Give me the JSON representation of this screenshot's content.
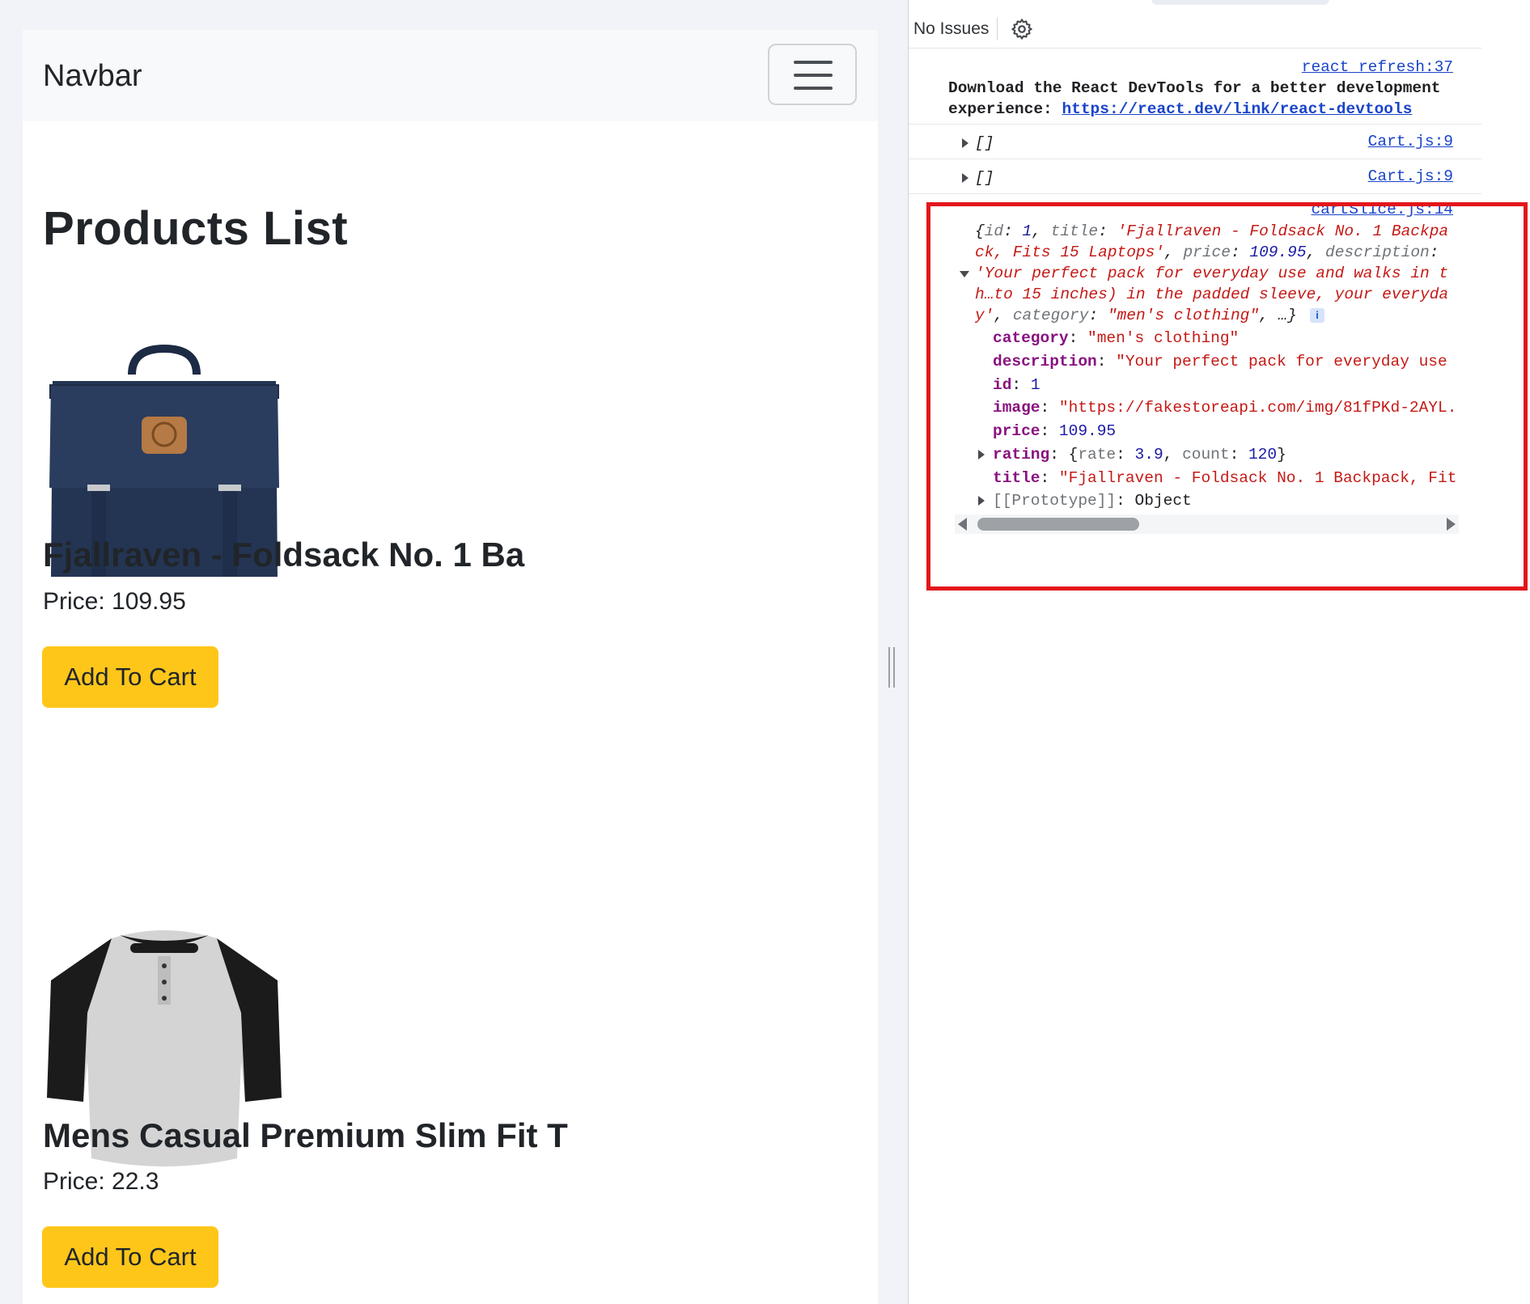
{
  "app": {
    "navbar": {
      "brand": "Navbar"
    },
    "page_title": "Products List",
    "products": [
      {
        "title": "Fjallraven - Foldsack No. 1 Ba",
        "price_text": "Price: 109.95",
        "button_label": "Add To Cart"
      },
      {
        "title": "Mens Casual Premium Slim Fit T",
        "price_text": "Price: 22.3",
        "button_label": "Add To Cart"
      }
    ]
  },
  "devtools": {
    "toolbar": {
      "issues_label": "No Issues"
    },
    "console": {
      "message1": {
        "source": "react_refresh:37",
        "text": "Download the React DevTools for a better development",
        "text2": "experience: ",
        "link": "https://react.dev/link/react-devtools"
      },
      "log1": {
        "value": "[]",
        "source": "Cart.js:9"
      },
      "log2": {
        "value": "[]",
        "source": "Cart.js:9"
      },
      "log3": {
        "source": "cartSlice.js:14",
        "summary": {
          "l1_open": "{",
          "l1_k1": "id",
          "l1_v1": "1",
          "l1_k2": "title",
          "l1_v2": "'Fjallraven - Foldsack No. 1 Backpa",
          "l2_v": "ck, Fits 15 Laptops'",
          "l2_k3": "price",
          "l2_v3": "109.95",
          "l2_k4": "description",
          "l3_v": "'Your perfect pack for everyday use and walks in t",
          "l4_v": "h…to 15 inches) in the padded sleeve, your everyda",
          "l5_v": "y'",
          "l5_k5": "category",
          "l5_v5": "\"men's clothing\"",
          "l5_close": ", …}",
          "info": "i"
        },
        "props": [
          {
            "key": "category",
            "value": "\"men's clothing\"",
            "kind": "string"
          },
          {
            "key": "description",
            "value": "\"Your perfect pack for everyday use",
            "kind": "string"
          },
          {
            "key": "id",
            "value": "1",
            "kind": "number"
          },
          {
            "key": "image",
            "value": "\"https://fakestoreapi.com/img/81fPKd-2AYL.",
            "kind": "string"
          },
          {
            "key": "price",
            "value": "109.95",
            "kind": "number"
          },
          {
            "key": "rating",
            "value_open": "{",
            "k1": "rate",
            "v1": "3.9",
            "k2": "count",
            "v2": "120",
            "value_close": "}",
            "kind": "object"
          },
          {
            "key": "title",
            "value": "\"Fjallraven - Foldsack No. 1 Backpack, Fit",
            "kind": "string"
          },
          {
            "key": "[[Prototype]]",
            "value": "Object",
            "kind": "proto"
          }
        ]
      }
    }
  },
  "colors": {
    "accent_button": "#ffc61a",
    "highlight": "#e3161b",
    "link": "#1a44c9"
  },
  "icons": [
    "hamburger-icon",
    "gear-icon",
    "backpack-image",
    "tshirt-image",
    "expand-arrow-icon",
    "collapse-arrow-icon",
    "info-icon"
  ]
}
